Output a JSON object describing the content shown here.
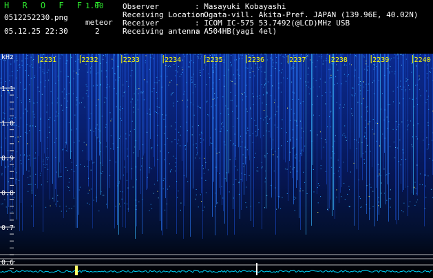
{
  "app": {
    "logo": "H R O F F T",
    "version": "1.00",
    "filename": "0512252230.png",
    "datetime": "05.12.25 22:30",
    "meteor_label": "meteor",
    "meteor_count": "2"
  },
  "station": [
    {
      "label": "Observer",
      "value": ": Masayuki Kobayashi"
    },
    {
      "label": "Receiving Location",
      "value": ": Ogata-vill. Akita-Pref. JAPAN (139.96E, 40.02N)"
    },
    {
      "label": "Receiver",
      "value": ": ICOM IC-575 53.7492(@LCD)MHz USB"
    },
    {
      "label": "Receiving antenna",
      "value": ": A504HB(yagi 4el)"
    }
  ],
  "chart_data": {
    "type": "heatmap",
    "ylabel": "kHz",
    "y_ticks": [
      "1.1",
      "1.0",
      "0.9",
      "0.8",
      "0.7",
      "0.6"
    ],
    "x_ticks": [
      "2231",
      "2232",
      "2233",
      "2234",
      "2235",
      "2236",
      "2237",
      "2238",
      "2239",
      "2240"
    ],
    "colors": {
      "bright": "#ffff66",
      "mid": "#2aa0ff",
      "low": "#0a2f9a",
      "bg": "#000000",
      "ticks": "#ffff00",
      "axis": "#d8d8d8",
      "noise": "#00d8ff"
    }
  }
}
